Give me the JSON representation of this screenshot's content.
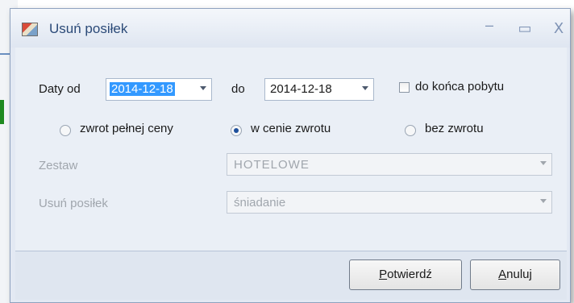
{
  "window": {
    "title": "Usuń posiłek",
    "controls": {
      "minimize": "–",
      "maximize": "▭",
      "close": "X"
    }
  },
  "dates": {
    "from_label": "Daty od",
    "from_value": "2014-12-18",
    "to_label": "do",
    "to_value": "2014-12-18",
    "until_end_label": "do końca pobytu",
    "until_end_checked": false
  },
  "refund": {
    "options": [
      {
        "label": "zwrot pełnej ceny",
        "selected": false
      },
      {
        "label": "w cenie zwrotu",
        "selected": true
      },
      {
        "label": "bez zwrotu",
        "selected": false
      }
    ]
  },
  "set": {
    "label": "Zestaw",
    "value": "HOTELOWE",
    "enabled": false
  },
  "meal": {
    "label": "Usuń posiłek",
    "value": "śniadanie",
    "enabled": false
  },
  "buttons": {
    "confirm": {
      "mnemonic": "P",
      "rest": "otwierdź"
    },
    "cancel": {
      "mnemonic": "A",
      "rest": "nuluj"
    }
  }
}
